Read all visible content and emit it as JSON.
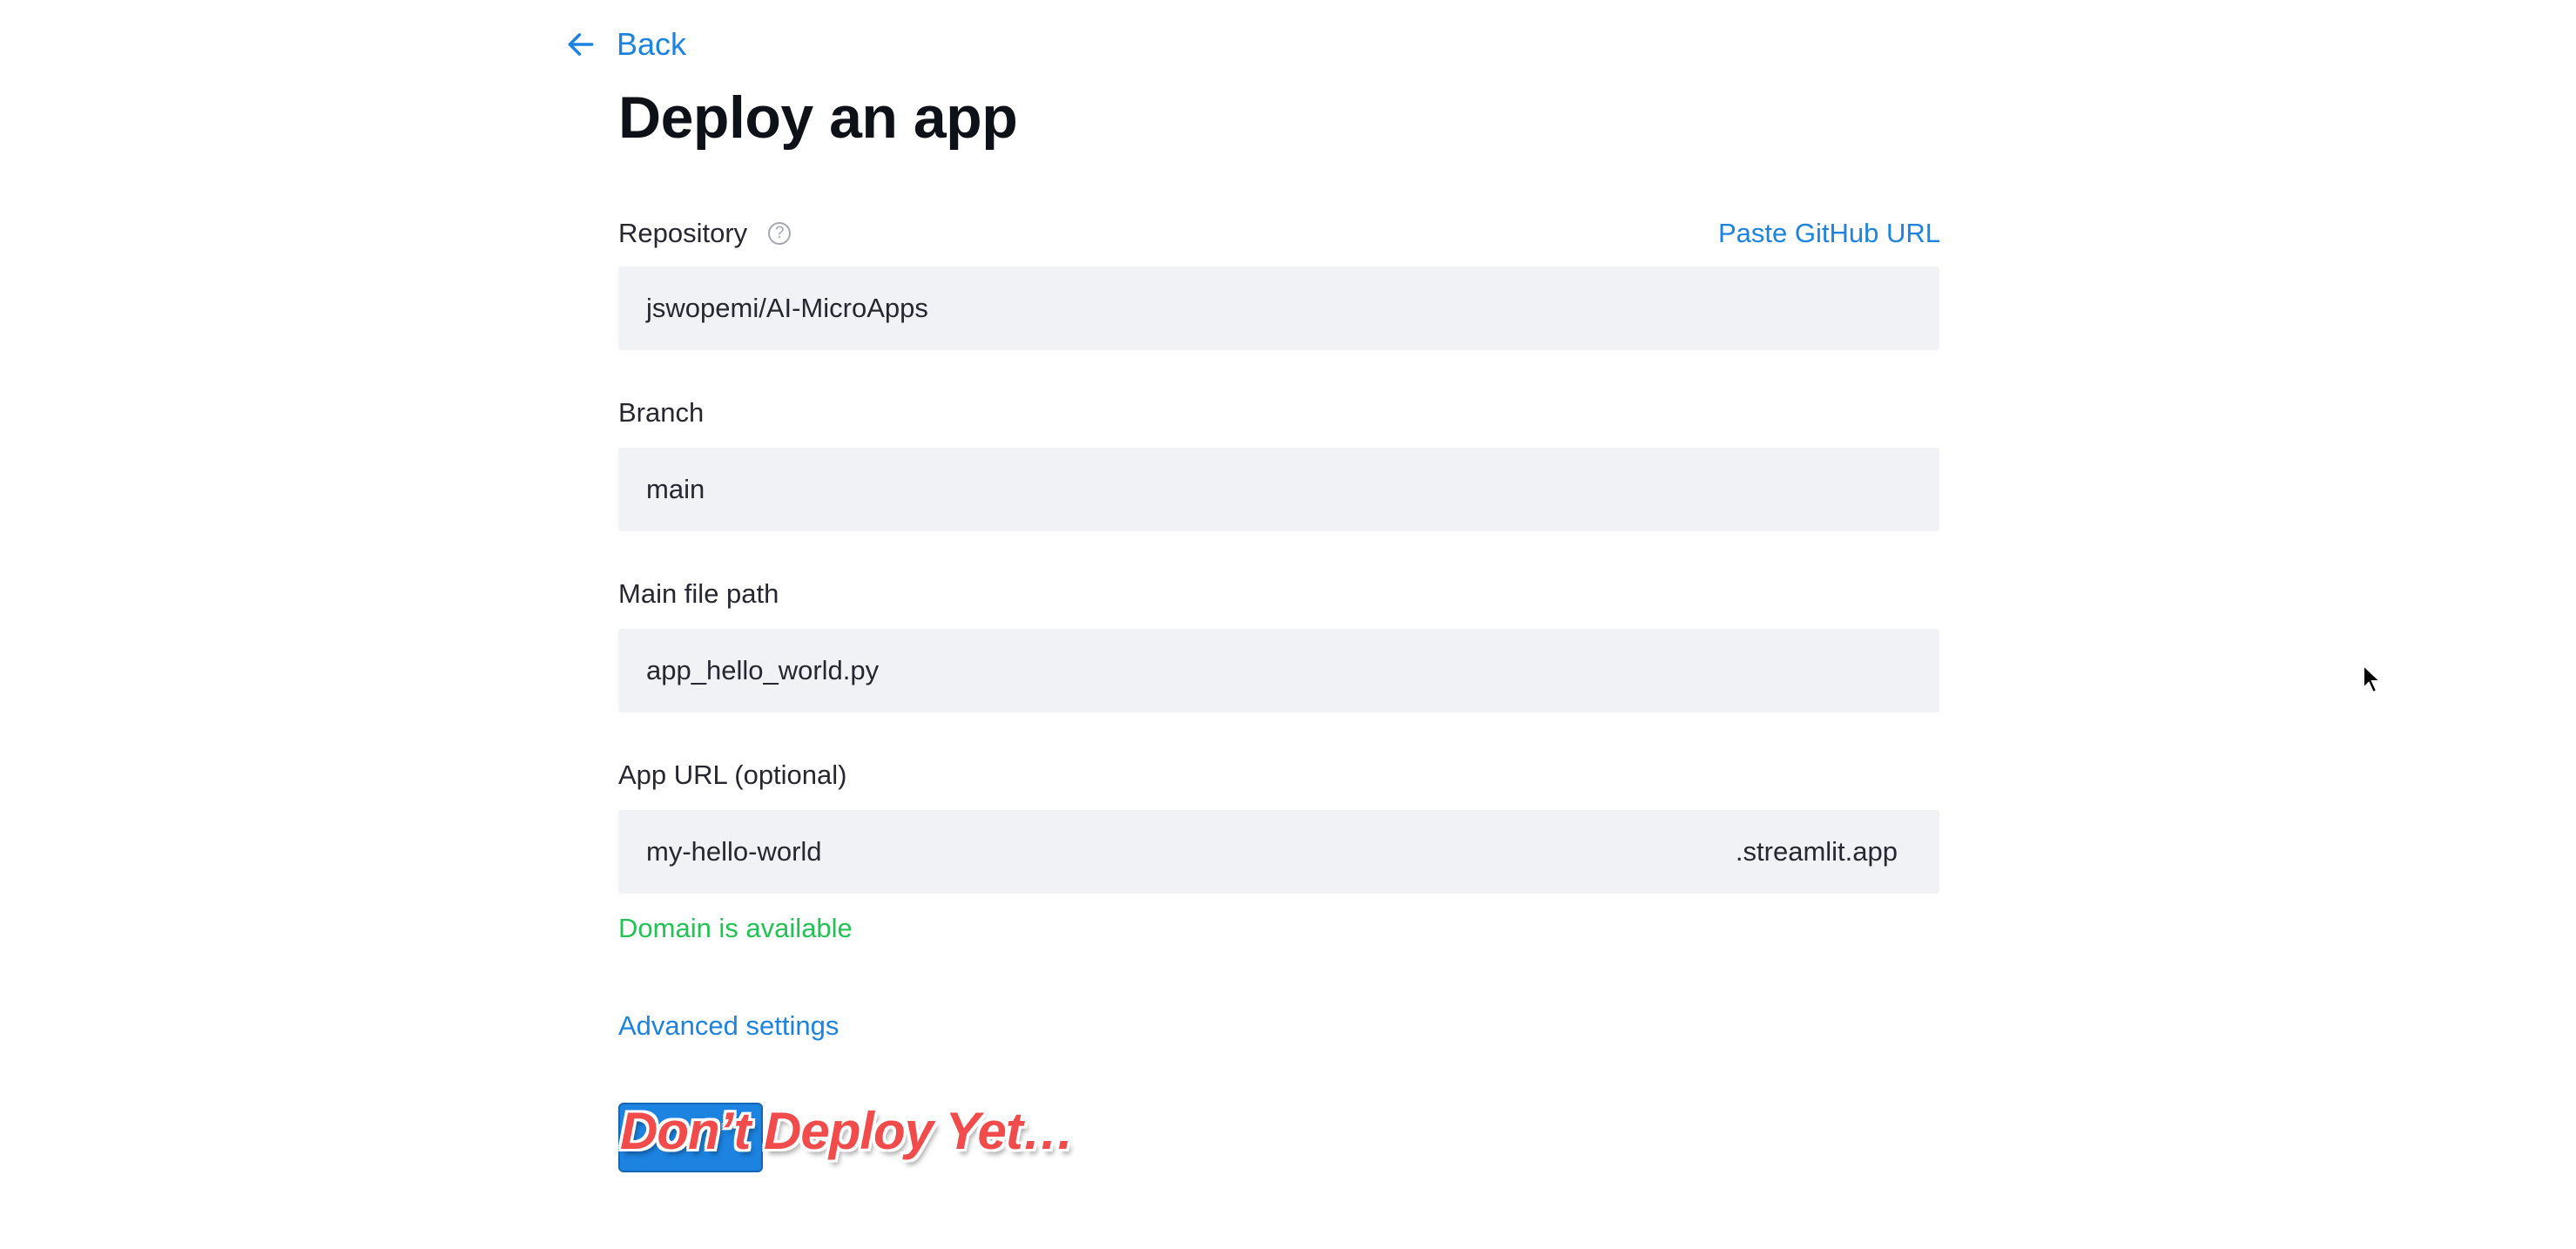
{
  "nav": {
    "back_label": "Back"
  },
  "page": {
    "title": "Deploy an app"
  },
  "repository": {
    "label": "Repository",
    "help_icon": "question-circle-icon",
    "paste_link": "Paste GitHub URL",
    "value": "jswopemi/AI-MicroApps"
  },
  "branch": {
    "label": "Branch",
    "value": "main"
  },
  "main_file": {
    "label": "Main file path",
    "value": "app_hello_world.py"
  },
  "app_url": {
    "label": "App URL (optional)",
    "value": "my-hello-world",
    "suffix": ".streamlit.app",
    "status": "Domain is available"
  },
  "advanced": {
    "label": "Advanced settings"
  },
  "overlay": {
    "text": "Don’t Deploy Yet…"
  },
  "colors": {
    "accent": "#1c83e1",
    "success": "#21c354",
    "input_bg": "#f0f2f6",
    "overlay_text": "#f24b4b"
  }
}
